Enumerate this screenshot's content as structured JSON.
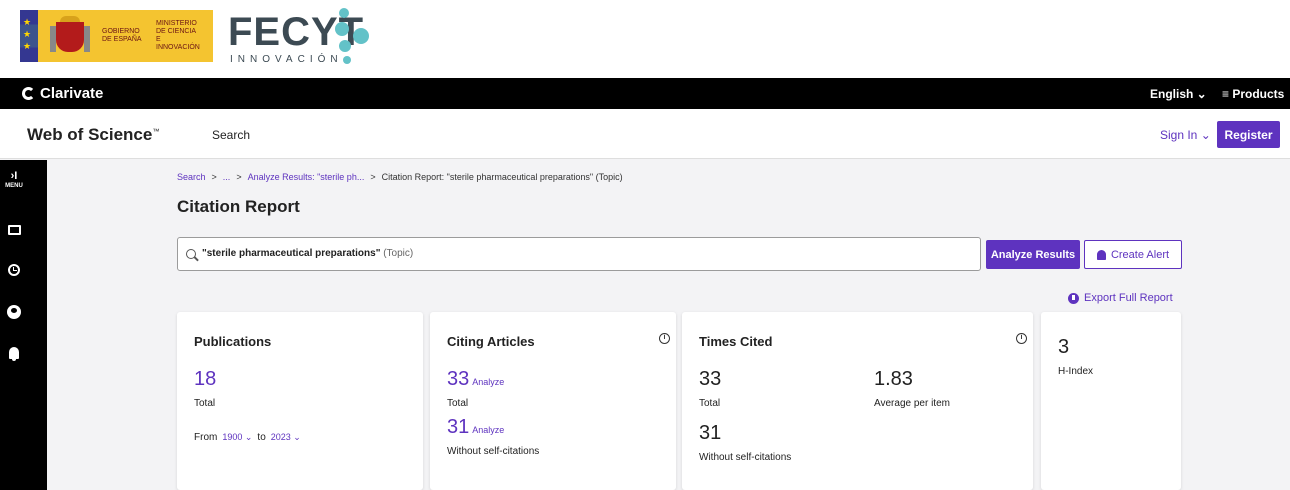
{
  "banner": {
    "gov_line1": "GOBIERNO",
    "gov_line2": "DE ESPAÑA",
    "min_line1": "MINISTERIO",
    "min_line2": "DE CIENCIA",
    "min_line3": "E INNOVACIÓN",
    "fecyt_name": "FECYT",
    "fecyt_sub": "INNOVACIÓN"
  },
  "clarivate": {
    "logo": "Clarivate",
    "language": "English ⌄",
    "products": "≡ Products"
  },
  "header": {
    "logo": "Web of Science",
    "logo_tm": "™",
    "search_nav": "Search",
    "sign_in": "Sign In ⌄",
    "register": "Register"
  },
  "rail": {
    "menu_arrow": "›I",
    "menu_label": "MENU"
  },
  "breadcrumb": {
    "search": "Search",
    "ellipsis": "...",
    "analyze": "Analyze Results: \"sterile ph...",
    "current": "Citation Report: \"sterile pharmaceutical preparations\" (Topic)",
    "sep": ">"
  },
  "page_title": "Citation Report",
  "search": {
    "query": "\"sterile pharmaceutical preparations\"",
    "field": " (Topic)"
  },
  "actions": {
    "analyze_results": "Analyze Results",
    "create_alert": "Create Alert",
    "export_full_report": "Export Full Report"
  },
  "cards": {
    "publications": {
      "title": "Publications",
      "value": "18",
      "value_label": "Total",
      "from_label": "From",
      "from_year": "1900 ⌄",
      "to_label": "to",
      "to_year": "2023 ⌄"
    },
    "citing": {
      "title": "Citing Articles",
      "total_value": "33",
      "analyze1": "Analyze",
      "total_label": "Total",
      "without_value": "31",
      "analyze2": "Analyze",
      "without_label": "Without self-citations"
    },
    "times_cited": {
      "title": "Times Cited",
      "total_value": "33",
      "total_label": "Total",
      "avg_value": "1.83",
      "avg_label": "Average per item",
      "without_value": "31",
      "without_label": "Without self-citations"
    },
    "hindex": {
      "value": "3",
      "label": "H-Index"
    }
  },
  "colors": {
    "accent": "#5e33bf",
    "black_bar": "#000000",
    "gov_yellow": "#f4c430",
    "fecyt_teal": "#63c2c8"
  }
}
